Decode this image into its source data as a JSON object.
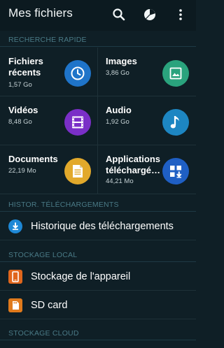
{
  "app": {
    "title": "Mes fichiers"
  },
  "sections": {
    "quick_search": "RECHERCHE RAPIDE",
    "download_history": "HISTOR. TÉLÉCHARGEMENTS",
    "local_storage": "STOCKAGE LOCAL",
    "cloud_storage": "STOCKAGE CLOUD"
  },
  "quick": {
    "recent": {
      "label": "Fichiers récents",
      "size": "1,57 Go",
      "color": "#1f74c9",
      "icon": "clock-icon"
    },
    "images": {
      "label": "Images",
      "size": "3,86 Go",
      "color": "#2aa37d",
      "icon": "image-icon"
    },
    "videos": {
      "label": "Vidéos",
      "size": "8,48 Go",
      "color": "#7a2fc7",
      "icon": "film-icon"
    },
    "audio": {
      "label": "Audio",
      "size": "1,92 Go",
      "color": "#1d86c2",
      "icon": "music-note-icon"
    },
    "documents": {
      "label": "Documents",
      "size": "22,19 Mo",
      "color": "#e2a92b",
      "icon": "document-icon"
    },
    "apps": {
      "label": "Applications téléchargé…",
      "size": "44,21 Mo",
      "color": "#1f5fc4",
      "icon": "apps-download-icon"
    }
  },
  "history": {
    "label": "Historique des téléchargements",
    "color": "#1e88d6",
    "icon": "download-icon"
  },
  "local": {
    "device": {
      "label": "Stockage de l'appareil",
      "color": "#e0661c",
      "icon": "phone-icon"
    },
    "sd": {
      "label": "SD card",
      "color": "#e07a1c",
      "icon": "sd-card-icon"
    }
  }
}
